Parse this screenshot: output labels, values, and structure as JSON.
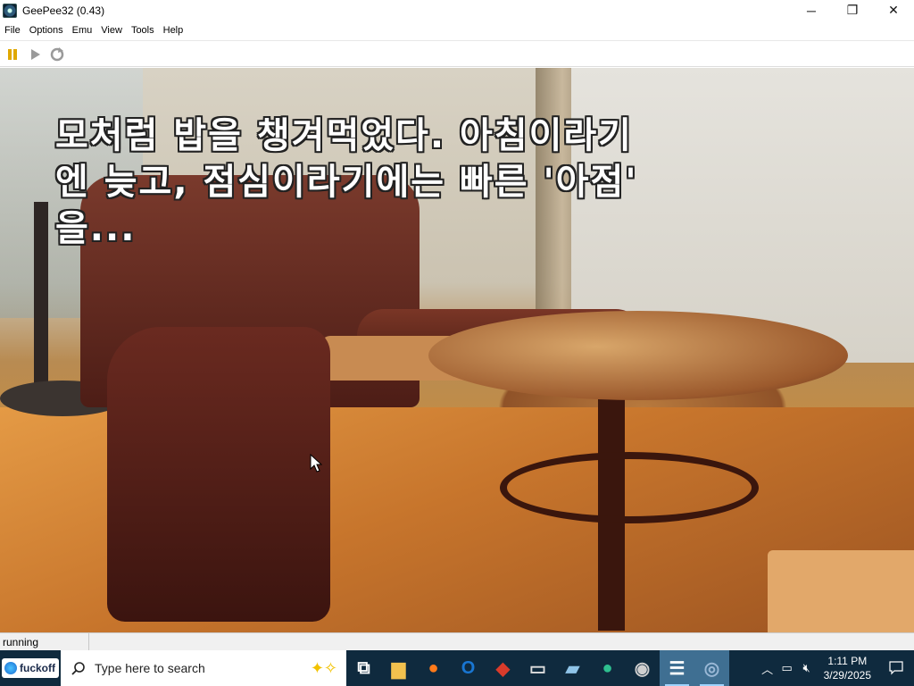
{
  "window": {
    "title": "GeePee32 (0.43)",
    "minimize": "─",
    "maximize": "❐",
    "close": "✕"
  },
  "menu": [
    "File",
    "Options",
    "Emu",
    "View",
    "Tools",
    "Help"
  ],
  "toolbar": {
    "icons": [
      "pause-icon",
      "play-icon",
      "reset-icon"
    ],
    "colors": {
      "pause": "#e0a800",
      "play": "#9a9a9a",
      "reset": "#9a9a9a"
    }
  },
  "game": {
    "text": "모처럼 밥을 챙겨먹었다. 아침이라기\n엔 늦고, 점심이라기에는 빠른 '아점'\n을..."
  },
  "status": {
    "state": "running"
  },
  "taskbar": {
    "start_label": "fuckoff",
    "search_placeholder": "Type here to search",
    "apps": [
      {
        "name": "task-view-icon",
        "glyph": "⧉",
        "color": "#ffffff",
        "active": false
      },
      {
        "name": "file-explorer-icon",
        "glyph": "▆",
        "color": "#f2c14e",
        "active": false
      },
      {
        "name": "firefox-icon",
        "glyph": "●",
        "color": "#ff7a1a",
        "active": false
      },
      {
        "name": "outlook-icon",
        "glyph": "O",
        "color": "#1976d2",
        "active": false
      },
      {
        "name": "pen-app-icon",
        "glyph": "◆",
        "color": "#d93b2b",
        "active": false
      },
      {
        "name": "terminal-icon",
        "glyph": "▭",
        "color": "#dddddd",
        "active": false
      },
      {
        "name": "notes-icon",
        "glyph": "▰",
        "color": "#8fc4e8",
        "active": false
      },
      {
        "name": "globe-app-icon",
        "glyph": "●",
        "color": "#2ebf8f",
        "active": false
      },
      {
        "name": "obs-icon",
        "glyph": "◉",
        "color": "#cfcfcf",
        "active": false
      },
      {
        "name": "list-app-icon",
        "glyph": "☰",
        "color": "#ffffff",
        "active": true
      },
      {
        "name": "geepee32-icon",
        "glyph": "◎",
        "color": "#9ab8d6",
        "active": true
      }
    ],
    "tray": {
      "time": "1:11 PM",
      "date": "3/29/2025",
      "icons": [
        "chevron-up-icon",
        "network-icon",
        "volume-muted-icon"
      ]
    }
  }
}
